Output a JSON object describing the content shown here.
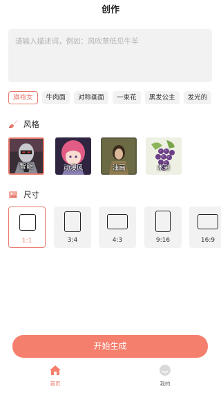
{
  "header": {
    "title": "创作"
  },
  "prompt": {
    "placeholder": "请输入描述词，例如：风吹草低见牛羊",
    "value": ""
  },
  "tags": [
    {
      "label": "旗袍女",
      "active": true
    },
    {
      "label": "牛肉面",
      "active": false
    },
    {
      "label": "对称画面",
      "active": false
    },
    {
      "label": "一束花",
      "active": false
    },
    {
      "label": "黑发公主",
      "active": false
    },
    {
      "label": "发光的",
      "active": false
    }
  ],
  "style_section": {
    "title": "风格",
    "icon": "paintbrush-icon",
    "items": [
      {
        "label": "智能",
        "selected": true
      },
      {
        "label": "动漫风",
        "selected": false
      },
      {
        "label": "油画",
        "selected": false
      },
      {
        "label": "水彩",
        "selected": false
      }
    ]
  },
  "size_section": {
    "title": "尺寸",
    "icon": "image-icon",
    "items": [
      {
        "label": "1:1",
        "selected": true
      },
      {
        "label": "3:4",
        "selected": false
      },
      {
        "label": "4:3",
        "selected": false
      },
      {
        "label": "9:16",
        "selected": false
      },
      {
        "label": "16:9",
        "selected": false
      }
    ]
  },
  "generate_button": {
    "label": "开始生成"
  },
  "tabbar": {
    "home": {
      "label": "首页",
      "icon": "home-icon",
      "active": true
    },
    "mine": {
      "label": "我的",
      "icon": "profile-icon",
      "active": false
    }
  },
  "colors": {
    "accent": "#e77a6d",
    "button": "#f57f6d",
    "card_bg": "#f2f2f2"
  }
}
